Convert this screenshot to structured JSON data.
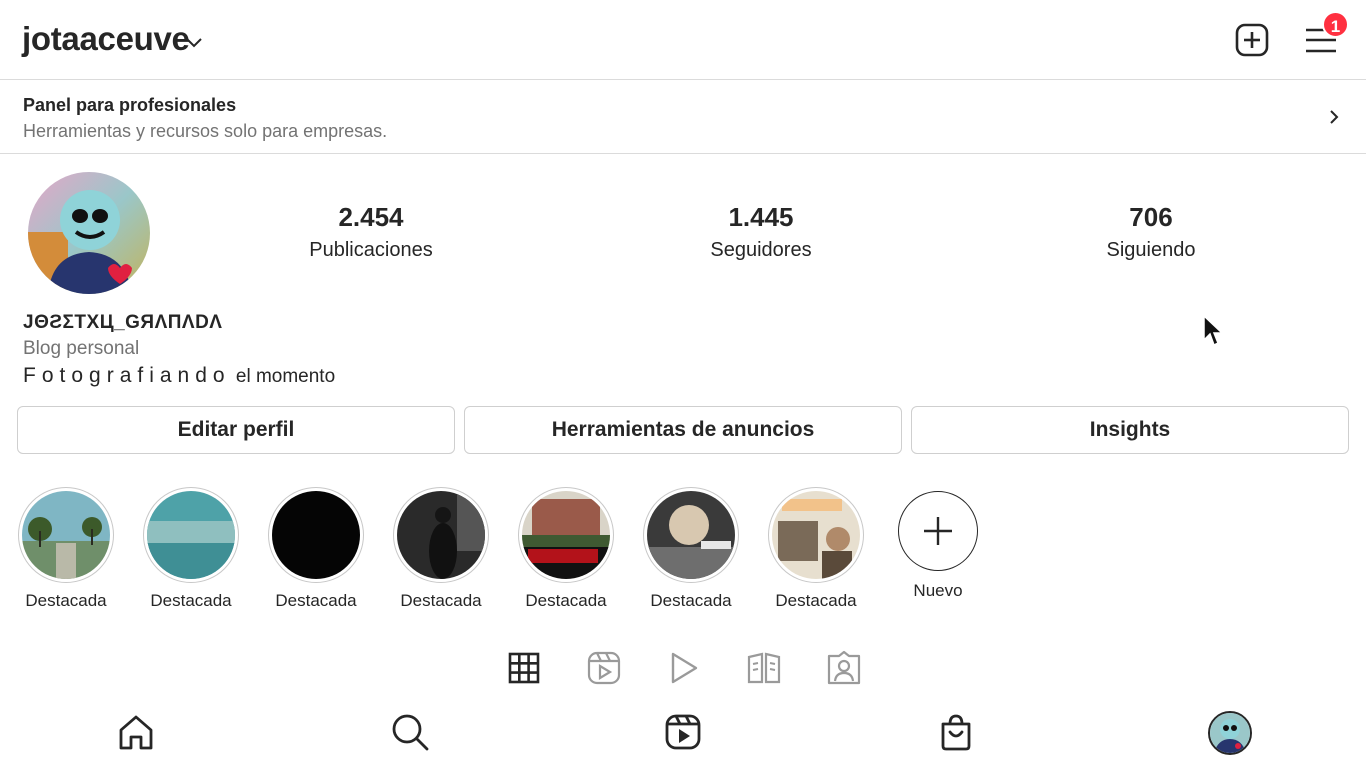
{
  "header": {
    "username": "jotaaceuve",
    "notification_count": "1"
  },
  "panel": {
    "title": "Panel para profesionales",
    "subtitle": "Herramientas y recursos solo para empresas."
  },
  "stats": [
    {
      "value": "2.454",
      "label": "Publicaciones"
    },
    {
      "value": "1.445",
      "label": "Seguidores"
    },
    {
      "value": "706",
      "label": "Siguiendo"
    }
  ],
  "profile": {
    "full_name": "JΘƧΣΤΧЦ_GЯΛПΛDΛ",
    "category": "Blog personal",
    "bio_spaced": "Fotografiando",
    "bio_rest": "el momento"
  },
  "buttons": {
    "edit": "Editar perfil",
    "ads": "Herramientas de anuncios",
    "insights": "Insights"
  },
  "highlights": [
    {
      "label": "Destacada"
    },
    {
      "label": "Destacada"
    },
    {
      "label": "Destacada"
    },
    {
      "label": "Destacada"
    },
    {
      "label": "Destacada"
    },
    {
      "label": "Destacada"
    },
    {
      "label": "Destacada"
    }
  ],
  "new_highlight": {
    "label": "Nuevo"
  },
  "colors": {
    "badge": "#ff3040",
    "text": "#262626",
    "muted": "#737373",
    "border": "#dbdbdb"
  }
}
